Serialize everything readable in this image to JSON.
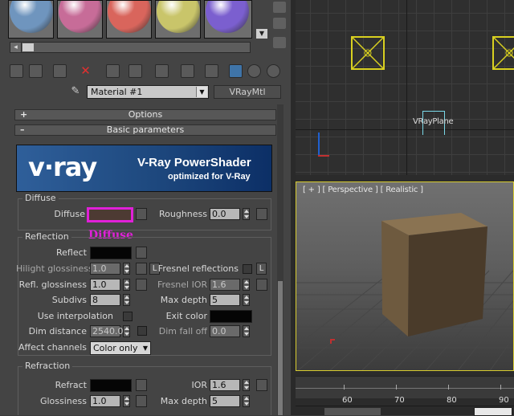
{
  "swatches": [
    {
      "name": "blue",
      "color": "#6f95be"
    },
    {
      "name": "pink",
      "color": "#c76c98"
    },
    {
      "name": "red",
      "color": "#d9655c"
    },
    {
      "name": "yellow",
      "color": "#c9c56a"
    },
    {
      "name": "purple",
      "color": "#7b5fcf"
    }
  ],
  "material": {
    "name": "Material #1",
    "type": "VRayMtl"
  },
  "rollouts": {
    "options": "Options",
    "basic": "Basic parameters",
    "plus": "+",
    "minus": "–"
  },
  "banner": {
    "brand": "v·ray",
    "title": "V-Ray PowerShader",
    "subtitle": "optimized for V-Ray"
  },
  "diffuse": {
    "group": "Diffuse",
    "diffuse_label": "Diffuse",
    "diffuse_color": "#4d3a33",
    "roughness_label": "Roughness",
    "roughness_value": "0.0",
    "annotation": "Diffuse",
    "annotation_color": "#e020d8"
  },
  "reflection": {
    "group": "Reflection",
    "reflect": "Reflect",
    "hilight": "Hilight glossiness",
    "hilight_value": "1.0",
    "refl_gloss": "Refl. glossiness",
    "refl_gloss_value": "1.0",
    "subdivs": "Subdivs",
    "subdivs_value": "8",
    "use_interp": "Use interpolation",
    "dim_distance": "Dim distance",
    "dim_distance_value": "2540.0",
    "affect_channels": "Affect channels",
    "affect_value": "Color only",
    "fresnel": "Fresnel reflections",
    "fresnel_ior": "Fresnel IOR",
    "fresnel_ior_value": "1.6",
    "max_depth": "Max depth",
    "max_depth_value": "5",
    "exit_color": "Exit color",
    "dim_falloff": "Dim fall off",
    "dim_falloff_value": "0.0",
    "l": "L"
  },
  "refraction": {
    "group": "Refraction",
    "refract": "Refract",
    "glossiness": "Glossiness",
    "glossiness_value": "1.0",
    "ior": "IOR",
    "ior_value": "1.6",
    "max_depth": "Max depth",
    "max_depth_value": "5"
  },
  "viewport_top": {
    "plane_label": "VRayPlane"
  },
  "viewport_persp": {
    "label": "[ + ] [ Perspective ] [ Realistic ]"
  },
  "timeline": {
    "ticks": [
      "60",
      "70",
      "80",
      "90"
    ]
  },
  "statusbar": {
    "left": "",
    "right": ""
  }
}
